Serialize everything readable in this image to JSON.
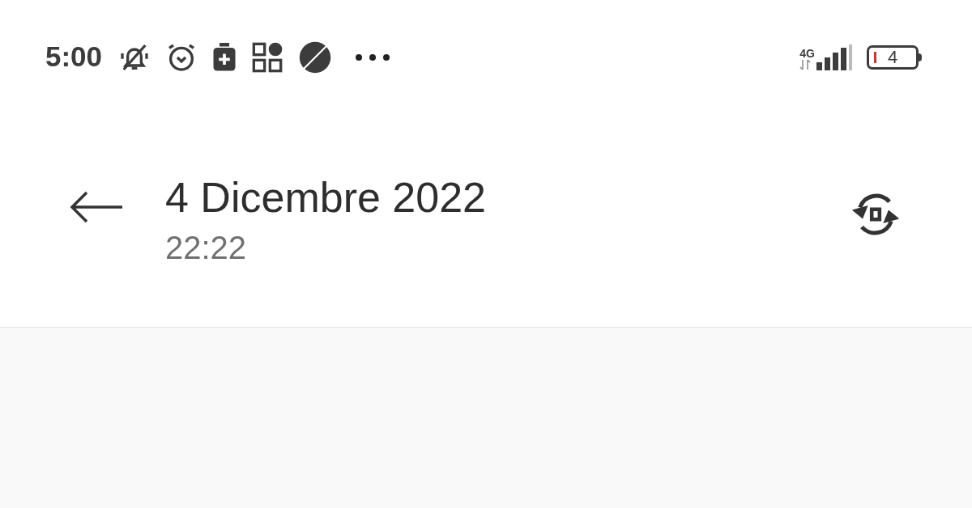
{
  "status_bar": {
    "time": "5:00",
    "network": "4G",
    "battery": "4"
  },
  "header": {
    "title": "4 Dicembre 2022",
    "subtitle": "22:22"
  }
}
